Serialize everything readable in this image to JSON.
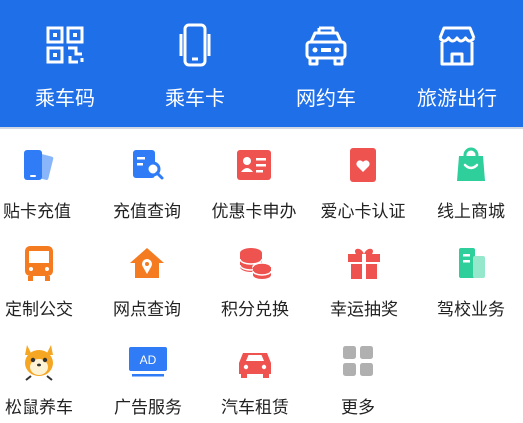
{
  "top_nav": [
    {
      "label": "乘车码",
      "icon": "qr-code-icon"
    },
    {
      "label": "乘车卡",
      "icon": "phone-card-icon"
    },
    {
      "label": "网约车",
      "icon": "taxi-icon"
    },
    {
      "label": "旅游出行",
      "icon": "storefront-icon"
    }
  ],
  "services": [
    {
      "label": "贴卡充值",
      "icon": "nfc-phone-card-icon"
    },
    {
      "label": "充值查询",
      "icon": "document-search-icon"
    },
    {
      "label": "优惠卡申办",
      "icon": "id-card-icon"
    },
    {
      "label": "爱心卡认证",
      "icon": "heart-card-icon"
    },
    {
      "label": "线上商城",
      "icon": "shopping-bag-icon"
    },
    {
      "label": "定制公交",
      "icon": "bus-icon"
    },
    {
      "label": "网点查询",
      "icon": "home-location-icon"
    },
    {
      "label": "积分兑换",
      "icon": "coins-icon"
    },
    {
      "label": "幸运抽奖",
      "icon": "gift-icon"
    },
    {
      "label": "驾校业务",
      "icon": "driving-school-icon"
    },
    {
      "label": "松鼠养车",
      "icon": "squirrel-icon"
    },
    {
      "label": "广告服务",
      "icon": "ad-screen-icon"
    },
    {
      "label": "汽车租赁",
      "icon": "car-icon"
    },
    {
      "label": "更多",
      "icon": "more-grid-icon"
    }
  ],
  "colors": {
    "header_blue": "#1f6fe9",
    "icon_blue": "#2f7cf6",
    "icon_red": "#ef5350",
    "icon_green": "#2ecf9b",
    "icon_orange": "#f47b20",
    "icon_gray": "#b0b0b0"
  }
}
